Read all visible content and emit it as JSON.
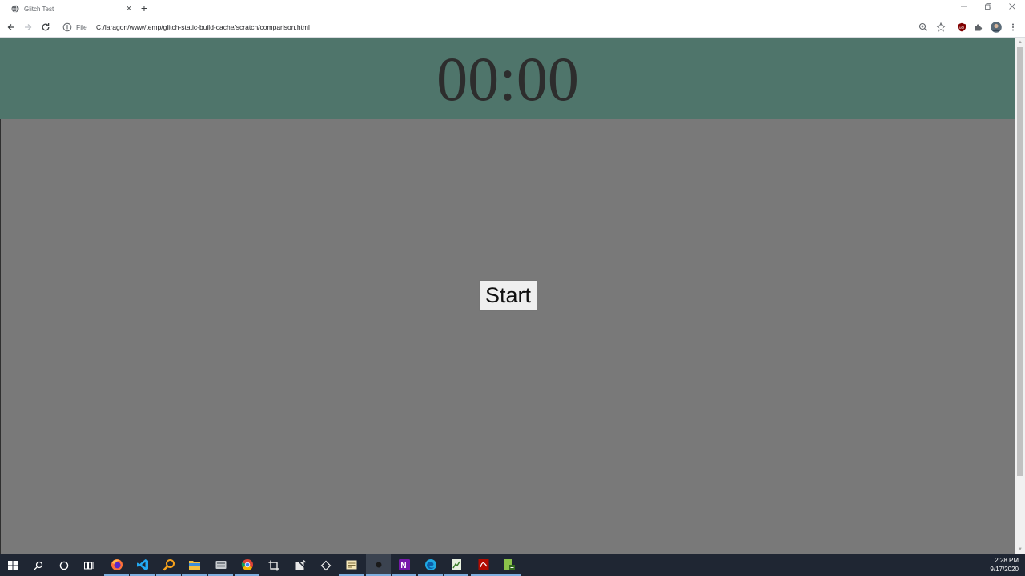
{
  "browser": {
    "tab_title": "Glitch Test",
    "tab_close": "×",
    "new_tab": "+",
    "scheme": "File",
    "url": "C:/laragon/www/temp/glitch-static-build-cache/scratch/comparison.html",
    "window_controls": [
      "minimize-icon",
      "restore-icon",
      "close-icon"
    ],
    "toolbar_icons": [
      "back-icon",
      "forward-icon",
      "reload-icon",
      "info-icon",
      "zoom-icon",
      "bookmark-star-icon",
      "ublock-icon",
      "extensions-icon",
      "profile-avatar"
    ]
  },
  "page": {
    "timer": "00:00",
    "start_label": "Start",
    "colors": {
      "timer_bar": "#4f756b",
      "pane": "#797979",
      "timer_text": "#2d2d2d"
    }
  },
  "taskbar": {
    "apps": [
      "start-icon",
      "search-icon",
      "cortana-icon",
      "task-view-icon",
      "firefox-icon",
      "vscode-icon",
      "search-tool-icon",
      "file-explorer-icon",
      "storage-icon",
      "chrome-icon",
      "crop-tool-icon",
      "editor-icon",
      "sync-icon",
      "notes-icon",
      "recorder-icon",
      "onenote-icon",
      "edge-icon",
      "spreadsheet-icon",
      "pdf-icon",
      "app-icon"
    ],
    "time": "2:28 PM",
    "date": "9/17/2020"
  }
}
